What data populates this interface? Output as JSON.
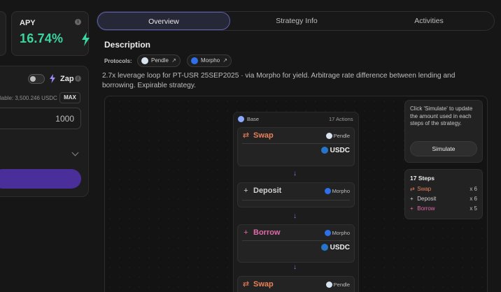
{
  "apy": {
    "title": "APY",
    "info": "i",
    "value": "16.74%"
  },
  "deposit": {
    "zap_label": "Zap",
    "info": "i",
    "available": "lable: 3,500.246 USDC",
    "max_label": "MAX",
    "amount": "1000",
    "primary_button_label": ""
  },
  "tabs": [
    {
      "label": "Overview"
    },
    {
      "label": "Strategy Info"
    },
    {
      "label": "Activities"
    }
  ],
  "description": {
    "heading": "Description",
    "protocols_label": "Protocols:",
    "protocols": [
      {
        "name": "Pendle",
        "arrow": "↗"
      },
      {
        "name": "Morpho",
        "arrow": "↗"
      }
    ],
    "text": "2.7x leverage loop for PT-USR 25SEP2025 · via Morpho for yield. Arbitrage rate difference between lending and borrowing. Expirable strategy."
  },
  "flow": {
    "base_label": "Base",
    "actions_count": "17 Actions",
    "steps": [
      {
        "icon": "⇄",
        "name": "Swap",
        "protocol": "Pendle",
        "token": "USDC"
      },
      {
        "icon": "+",
        "name": "Deposit",
        "protocol": "Morpho",
        "token": ""
      },
      {
        "icon": "+",
        "name": "Borrow",
        "protocol": "Morpho",
        "token": "USDC"
      },
      {
        "icon": "⇄",
        "name": "Swap",
        "protocol": "Pendle",
        "token": ""
      }
    ],
    "arrow": "↓"
  },
  "simulate": {
    "text": "Click 'Simulate' to update the amount used in each steps of the strategy.",
    "button_label": "Simulate"
  },
  "summary": {
    "title": "17 Steps",
    "rows": [
      {
        "icon": "⇄",
        "label": "Swap",
        "count": "x 6"
      },
      {
        "icon": "+",
        "label": "Deposit",
        "count": "x 6"
      },
      {
        "icon": "+",
        "label": "Borrow",
        "count": "x 5"
      }
    ]
  },
  "colors": {
    "apy_green": "#3ad6a0",
    "accent_purple": "#4a2f9a",
    "swap_orange": "#e8805a",
    "deposit_gray": "#cfcfcf",
    "borrow_pink": "#e06aa8",
    "usdc_blue": "#2775ca"
  }
}
